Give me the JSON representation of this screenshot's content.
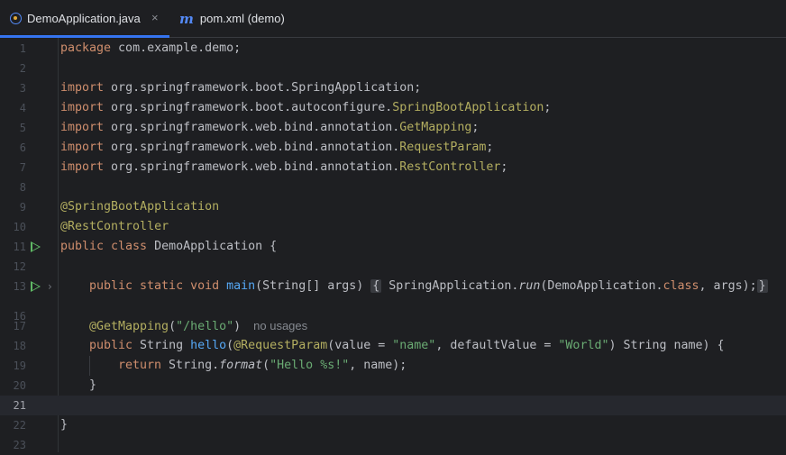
{
  "tabs": [
    {
      "label": "DemoApplication.java",
      "active": true,
      "close": "×"
    },
    {
      "label": "pom.xml (demo)",
      "active": false
    }
  ],
  "lines": {
    "n1": "1",
    "n2": "2",
    "n3": "3",
    "n4": "4",
    "n5": "5",
    "n6": "6",
    "n7": "7",
    "n8": "8",
    "n9": "9",
    "n10": "10",
    "n11": "11",
    "n12": "12",
    "n13": "13",
    "n16": "16",
    "n17": "17",
    "n18": "18",
    "n19": "19",
    "n20": "20",
    "n21": "21",
    "n22": "22",
    "n23": "23"
  },
  "code": {
    "l1_kw": "package",
    "l1_rest": " com.example.demo;",
    "import_kw": "import",
    "l3_rest": " org.springframework.boot.SpringApplication;",
    "l4_a": " org.springframework.boot.autoconfigure.",
    "l4_b": "SpringBootApplication",
    "l4_c": ";",
    "l5_a": " org.springframework.web.bind.annotation.",
    "l5_b": "GetMapping",
    "l5_c": ";",
    "l6_a": " org.springframework.web.bind.annotation.",
    "l6_b": "RequestParam",
    "l6_c": ";",
    "l7_a": " org.springframework.web.bind.annotation.",
    "l7_b": "RestController",
    "l7_c": ";",
    "l9": "@SpringBootApplication",
    "l10": "@RestController",
    "l11_kw": "public class",
    "l11_rest": " DemoApplication {",
    "l13_kw": "public static void",
    "l13_fn": "main",
    "l13_a": "(String[] args)",
    "l13_fold_open": "{",
    "l13_b": " SpringApplication.",
    "l13_run": "run",
    "l13_c": "(DemoApplication.",
    "l13_class": "class",
    "l13_d": ", args);",
    "l13_fold_close": "}",
    "l17_ann": "@GetMapping",
    "l17_a": "(",
    "l17_str": "\"/hello\"",
    "l17_b": ")",
    "l17_hint": "no usages",
    "l18_kw": "public",
    "l18_a": " String ",
    "l18_fn": "hello",
    "l18_b": "(",
    "l18_ann": "@RequestParam",
    "l18_c": "(value = ",
    "l18_s1": "\"name\"",
    "l18_d": ", defaultValue = ",
    "l18_s2": "\"World\"",
    "l18_e": ") String name) {",
    "l19_kw": "return",
    "l19_a": " String.",
    "l19_fmt": "format",
    "l19_b": "(",
    "l19_str": "\"Hello %s!\"",
    "l19_c": ", name);",
    "l20": "}",
    "l22": "}"
  }
}
